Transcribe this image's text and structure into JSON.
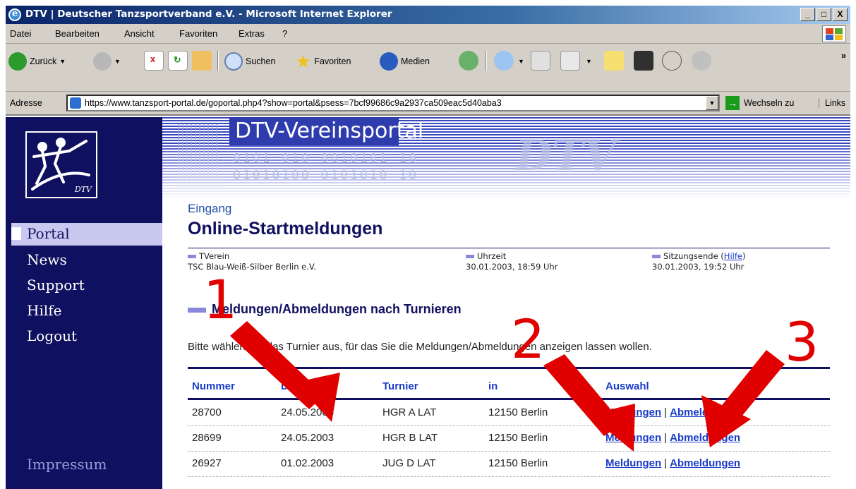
{
  "window": {
    "title": "DTV | Deutscher Tanzsportverband e.V. - Microsoft Internet Explorer",
    "controls": [
      "_",
      "□",
      "X"
    ]
  },
  "menubar": {
    "items": [
      "Datei",
      "Bearbeiten",
      "Ansicht",
      "Favoriten",
      "Extras",
      "?"
    ]
  },
  "toolbar": {
    "back_label": "Zurück",
    "search_label": "Suchen",
    "favorites_label": "Favoriten",
    "media_label": "Medien",
    "overflow": "»"
  },
  "addressbar": {
    "label": "Adresse",
    "url": "https://www.tanzsport-portal.de/goportal.php4?show=portal&psess=7bcf99686c9a2937ca509eac5d40aba3",
    "go_label": "Wechseln zu",
    "links_label": "Links"
  },
  "sidebar": {
    "logo_text": "DTV",
    "active": "Portal",
    "items": [
      "News",
      "Support",
      "Hilfe",
      "Logout"
    ],
    "footer": "Impressum"
  },
  "banner": {
    "title": "DTV-Vereinsportal",
    "binary1": "0101 010 0010101 10",
    "binary2": "01010100 0101010 10",
    "watermark": "DTV"
  },
  "main": {
    "breadcrumb": "Eingang",
    "title": "Online-Startmeldungen",
    "info": {
      "verein_label": "TVerein",
      "verein_value": "TSC Blau-Weiß-Silber Berlin e.V.",
      "time_label": "Uhrzeit",
      "time_value": "30.01.2003, 18:59 Uhr",
      "session_label": "Sitzungsende (",
      "session_help": "Hilfe",
      "session_close": ")",
      "session_value": "30.01.2003, 19:52 Uhr"
    },
    "section_heading": "Meldungen/Abmeldungen nach Turnieren",
    "instruction": "Bitte wählen Sie das Turnier aus, für das Sie die Meldungen/Abmeldungen anzeigen lassen wollen."
  },
  "table": {
    "headers": [
      "Nummer",
      "Datum",
      "Turnier",
      "in",
      "Auswahl"
    ],
    "rows": [
      {
        "nummer": "28700",
        "datum": "24.05.2003",
        "turnier": "HGR A LAT",
        "ort": "12150 Berlin",
        "meldungen": "Meldungen",
        "abmeldungen": "Abmeldungen"
      },
      {
        "nummer": "28699",
        "datum": "24.05.2003",
        "turnier": "HGR B LAT",
        "ort": "12150 Berlin",
        "meldungen": "Meldungen",
        "abmeldungen": "Abmeldungen"
      },
      {
        "nummer": "26927",
        "datum": "01.02.2003",
        "turnier": "JUG D LAT",
        "ort": "12150 Berlin",
        "meldungen": "Meldungen",
        "abmeldungen": "Abmeldungen"
      }
    ],
    "separator": "|"
  },
  "annotations": {
    "labels": [
      "1",
      "2",
      "3"
    ],
    "color": "#e00000"
  }
}
